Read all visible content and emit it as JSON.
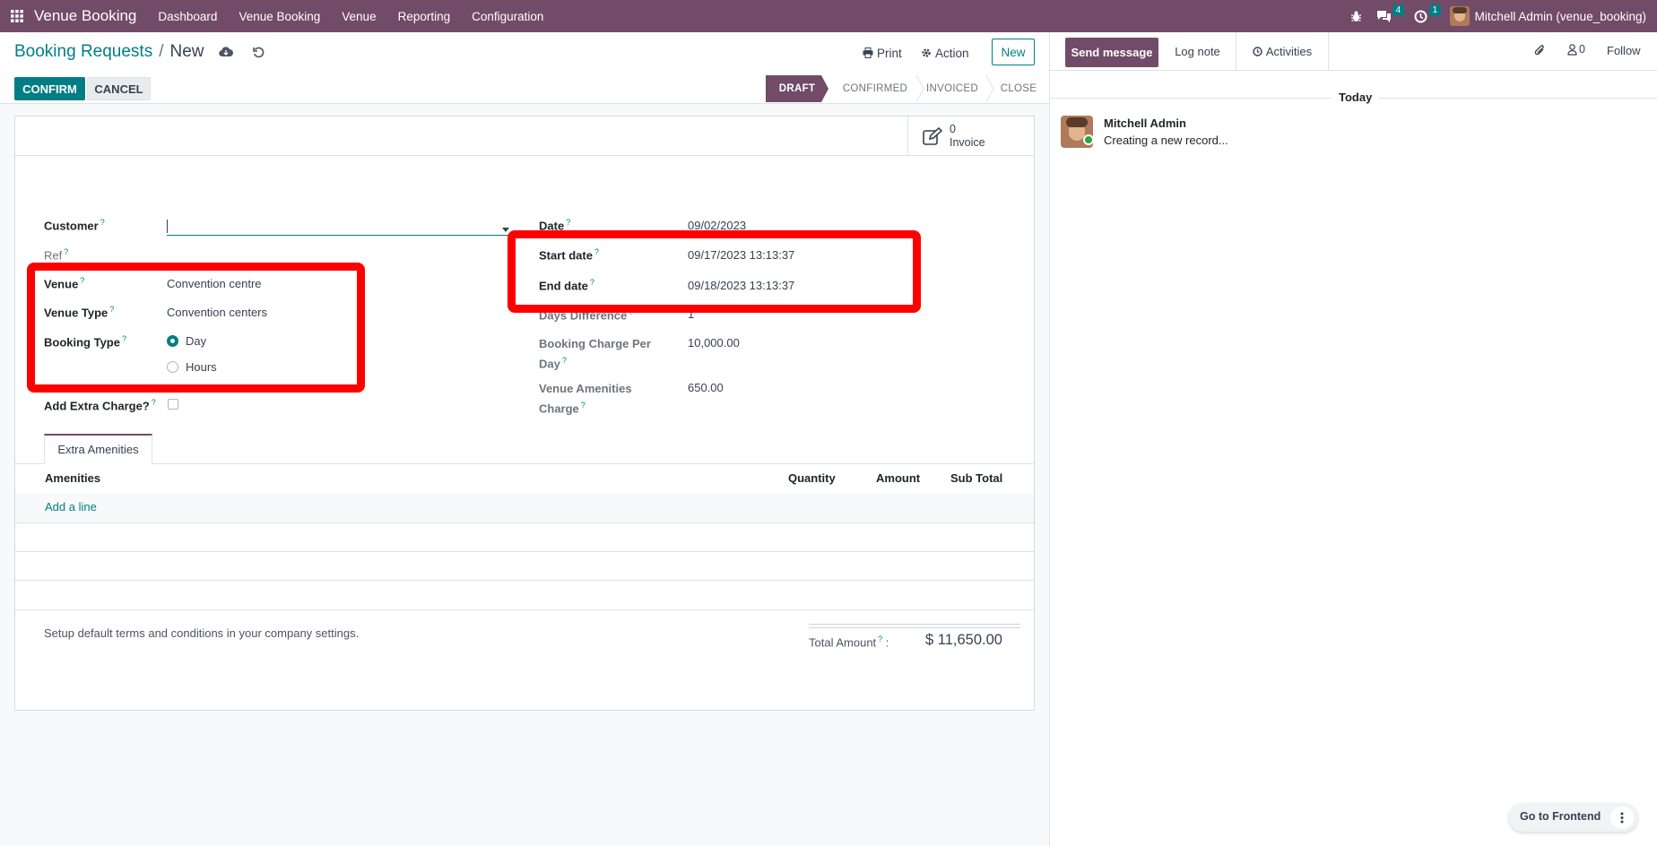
{
  "navbar": {
    "app_name": "Venue Booking",
    "menu": [
      "Dashboard",
      "Venue Booking",
      "Venue",
      "Reporting",
      "Configuration"
    ],
    "messages_count": "4",
    "activities_count": "1",
    "user": "Mitchell Admin (venue_booking)"
  },
  "control_panel": {
    "breadcrumb_parent": "Booking Requests",
    "breadcrumb_separator": "/",
    "breadcrumb_current": "New",
    "print_label": "Print",
    "action_label": "Action",
    "new_label": "New"
  },
  "form_actions": {
    "confirm_label": "CONFIRM",
    "cancel_label": "CANCEL"
  },
  "status_bar": {
    "steps": [
      "DRAFT",
      "CONFIRMED",
      "INVOICED",
      "CLOSE"
    ],
    "active": "DRAFT"
  },
  "smart_button": {
    "count": "0",
    "label": "Invoice"
  },
  "form": {
    "customer_label": "Customer",
    "customer_value": "",
    "ref_label": "Ref",
    "venue_label": "Venue",
    "venue_value": "Convention centre",
    "venue_type_label": "Venue Type",
    "venue_type_value": "Convention centers",
    "booking_type_label": "Booking Type",
    "booking_type_options": [
      "Day",
      "Hours"
    ],
    "booking_type_selected": "Day",
    "add_extra_charge_label": "Add Extra Charge?",
    "add_extra_charge_checked": false,
    "date_label": "Date",
    "date_value": "09/02/2023",
    "start_date_label": "Start date",
    "start_date_value": "09/17/2023 13:13:37",
    "end_date_label": "End date",
    "end_date_value": "09/18/2023 13:13:37",
    "days_difference_label": "Days Difference",
    "days_difference_value": "1",
    "booking_charge_label_1": "Booking Charge Per",
    "booking_charge_label_2": "Day",
    "booking_charge_value": "10,000.00",
    "amenities_charge_label_1": "Venue Amenities",
    "amenities_charge_label_2": "Charge",
    "amenities_charge_value": "650.00"
  },
  "notebook": {
    "tab_label": "Extra Amenities",
    "columns": [
      "Amenities",
      "Quantity",
      "Amount",
      "Sub Total"
    ],
    "add_line_label": "Add a line"
  },
  "footer": {
    "terms_text": "Setup default terms and conditions in your company settings.",
    "total_label": "Total Amount",
    "total_value": "$ 11,650.00"
  },
  "chatter": {
    "send_message_label": "Send message",
    "log_note_label": "Log note",
    "activities_label": "Activities",
    "followers_count": "0",
    "follow_label": "Follow",
    "date_separator": "Today",
    "message_author": "Mitchell Admin",
    "message_body": "Creating a new record..."
  },
  "floating": {
    "go_to_frontend_label": "Go to Frontend"
  },
  "colors": {
    "brand": "#714b67",
    "accent": "#017e84",
    "highlight": "#ff0000"
  }
}
